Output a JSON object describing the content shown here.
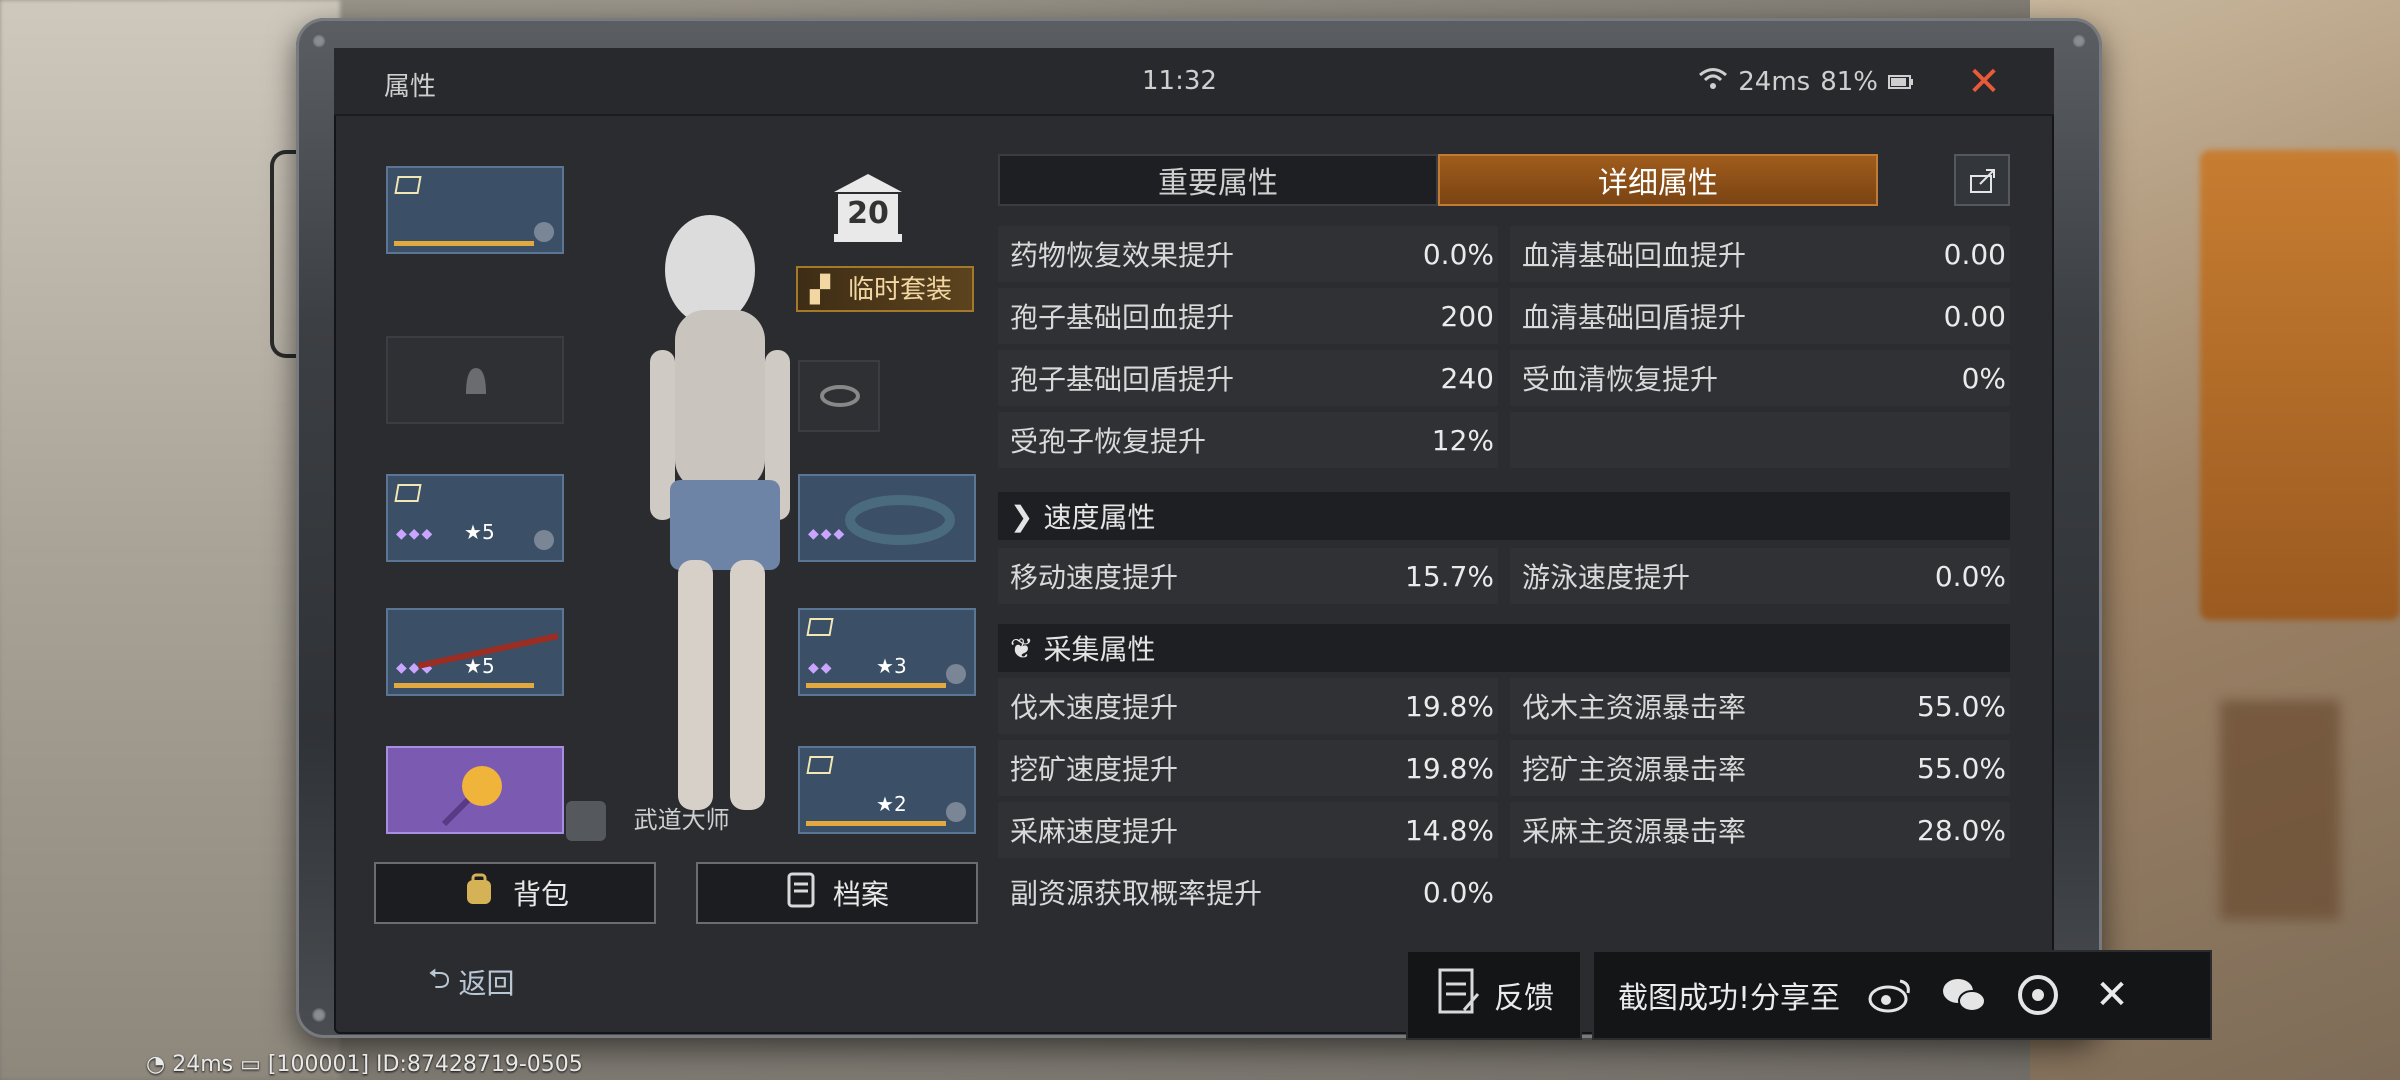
{
  "status": {
    "title": "属性",
    "time": "11:32",
    "ping": "24ms",
    "battery": "81%"
  },
  "left": {
    "rank_number": "20",
    "temp_set_label": "临时套装",
    "master_label": "武道大师",
    "backpack_label": "背包",
    "archive_label": "档案",
    "back_label": "返回",
    "slots": [
      {
        "name": "helmet",
        "stars": ""
      },
      {
        "name": "empty-slot",
        "stars": ""
      },
      {
        "name": "armor",
        "stars": "5"
      },
      {
        "name": "weapon",
        "stars": "5"
      },
      {
        "name": "special",
        "stars": ""
      },
      {
        "name": "ring-small",
        "stars": ""
      },
      {
        "name": "bracelet",
        "stars": ""
      },
      {
        "name": "module",
        "stars": "3"
      },
      {
        "name": "gadget",
        "stars": "2"
      }
    ]
  },
  "tabs": {
    "important": "重要属性",
    "detailed": "详细属性"
  },
  "attributes": {
    "row1": [
      {
        "label": "药物恢复效果提升",
        "value": "0.0%"
      },
      {
        "label": "血清基础回血提升",
        "value": "0.00"
      }
    ],
    "row2": [
      {
        "label": "孢子基础回血提升",
        "value": "200"
      },
      {
        "label": "血清基础回盾提升",
        "value": "0.00"
      }
    ],
    "row3": [
      {
        "label": "孢子基础回盾提升",
        "value": "240"
      },
      {
        "label": "受血清恢复提升",
        "value": "0%"
      }
    ],
    "row4": [
      {
        "label": "受孢子恢复提升",
        "value": "12%"
      }
    ],
    "speed_header": "速度属性",
    "speed": [
      {
        "label": "移动速度提升",
        "value": "15.7%"
      },
      {
        "label": "游泳速度提升",
        "value": "0.0%"
      }
    ],
    "gather_header": "采集属性",
    "gather1": [
      {
        "label": "伐木速度提升",
        "value": "19.8%"
      },
      {
        "label": "伐木主资源暴击率",
        "value": "55.0%"
      }
    ],
    "gather2": [
      {
        "label": "挖矿速度提升",
        "value": "19.8%"
      },
      {
        "label": "挖矿主资源暴击率",
        "value": "55.0%"
      }
    ],
    "gather3": [
      {
        "label": "采麻速度提升",
        "value": "14.8%"
      },
      {
        "label": "采麻主资源暴击率",
        "value": "28.0%"
      }
    ],
    "gather4": [
      {
        "label": "副资源获取概率提升",
        "value": "0.0%"
      }
    ]
  },
  "share": {
    "feedback_label": "反馈",
    "success_text": "截图成功!分享至"
  },
  "footer": {
    "ping": "24ms",
    "id_text": "[100001] ID:87428719-0505"
  }
}
